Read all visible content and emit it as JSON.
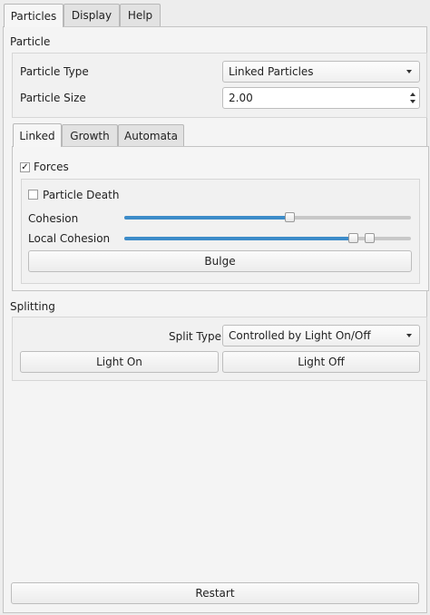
{
  "main_tabs": [
    {
      "label": "Particles",
      "active": true
    },
    {
      "label": "Display",
      "active": false
    },
    {
      "label": "Help",
      "active": false
    }
  ],
  "particle_section": {
    "title": "Particle",
    "type_label": "Particle Type",
    "type_value": "Linked Particles",
    "size_label": "Particle Size",
    "size_value": "2.00"
  },
  "sub_tabs": [
    {
      "label": "Linked",
      "active": true
    },
    {
      "label": "Growth",
      "active": false
    },
    {
      "label": "Automata",
      "active": false
    }
  ],
  "linked": {
    "forces_label": "Forces",
    "forces_checked": true,
    "death_label": "Particle Death",
    "death_checked": false,
    "cohesion_label": "Cohesion",
    "cohesion_value": 0.58,
    "local_cohesion_label": "Local Cohesion",
    "local_cohesion_lower": 0.81,
    "local_cohesion_upper": 0.87,
    "bulge_button": "Bulge"
  },
  "splitting": {
    "title": "Splitting",
    "split_type_label": "Split Type",
    "split_type_value": "Controlled by Light On/Off",
    "light_on_button": "Light On",
    "light_off_button": "Light Off"
  },
  "restart_button": "Restart",
  "colors": {
    "accent": "#3d8cc9"
  }
}
